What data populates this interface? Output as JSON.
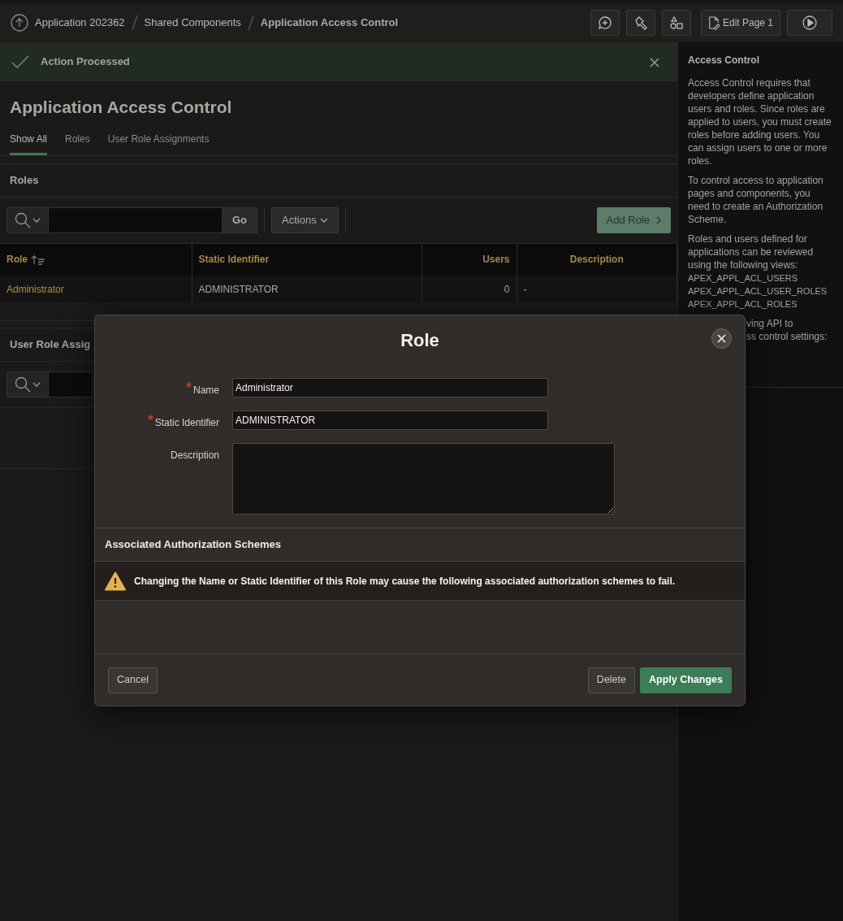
{
  "breadcrumb": [
    {
      "label": "Application 202362",
      "current": false
    },
    {
      "label": "Shared Components",
      "current": false
    },
    {
      "label": "Application Access Control",
      "current": true
    }
  ],
  "edit_page_button": "Edit Page 1",
  "alert": {
    "message": "Action Processed"
  },
  "page_title": "Application Access Control",
  "tabs": [
    {
      "label": "Show All",
      "selected": true
    },
    {
      "label": "Roles",
      "selected": false
    },
    {
      "label": "User Role Assignments",
      "selected": false
    }
  ],
  "roles_region": {
    "title": "Roles",
    "go_button": "Go",
    "actions_button": "Actions",
    "add_button": "Add Role",
    "columns": [
      {
        "label": "Role",
        "sorted": true
      },
      {
        "label": "Static Identifier",
        "sorted": false
      },
      {
        "label": "Users",
        "sorted": false
      },
      {
        "label": "Description",
        "sorted": false
      }
    ],
    "rows": [
      [
        "Administrator",
        "ADMINISTRATOR",
        "0",
        "-"
      ]
    ]
  },
  "assignments_region": {
    "title": "User Role Assig"
  },
  "help": {
    "title": "Access Control",
    "paragraphs": [
      "Access Control requires that developers define application users and roles. Since roles are applied to users, you must create roles before adding users. You can assign users to one or more roles.",
      "To control access to application pages and components, you need to create an Authorization Scheme.",
      "Roles and users defined for applications can be reviewed using the following views:"
    ],
    "views": [
      "APEX_APPL_ACL_USERS",
      "APEX_APPL_ACL_USER_ROLES",
      "APEX_APPL_ACL_ROLES"
    ],
    "partial_lines": [
      "ving API to",
      "ss control settings:"
    ]
  },
  "dialog": {
    "title": "Role",
    "fields": [
      {
        "label": "Name",
        "required": true,
        "kind": "text",
        "value": "Administrator"
      },
      {
        "label": "Static Identifier",
        "required": true,
        "kind": "text",
        "value": "ADMINISTRATOR"
      },
      {
        "label": "Description",
        "required": false,
        "kind": "textarea"
      }
    ],
    "section_title": "Associated Authorization Schemes",
    "warning": "Changing the Name or Static Identifier of this Role may cause the following associated authorization schemes to fail.",
    "left_buttons": [
      {
        "label": "Cancel",
        "kind": "secondary"
      }
    ],
    "right_buttons": [
      {
        "label": "Delete",
        "kind": "secondary"
      },
      {
        "label": "Apply Changes",
        "kind": "primary"
      }
    ]
  }
}
